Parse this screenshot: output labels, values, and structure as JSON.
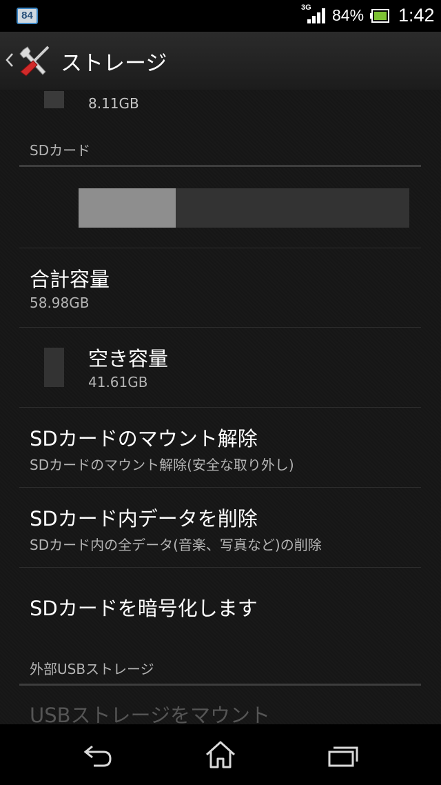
{
  "status_bar": {
    "notification_badge": "84",
    "network_type": "3G",
    "battery_percent": "84%",
    "time": "1:42",
    "icons": [
      "notification-badge-icon",
      "signal-icon",
      "battery-icon"
    ]
  },
  "action_bar": {
    "title": "ストレージ",
    "icons": [
      "back-caret-icon",
      "settings-tools-icon"
    ]
  },
  "internal": {
    "partial_size": "8.11GB"
  },
  "sd_section": {
    "header": "SDカード",
    "usage_used_fraction": 0.2945,
    "total": {
      "title": "合計容量",
      "value": "58.98GB"
    },
    "free": {
      "title": "空き容量",
      "value": "41.61GB"
    },
    "unmount": {
      "title": "SDカードのマウント解除",
      "subtitle": "SDカードのマウント解除(安全な取り外し)"
    },
    "erase": {
      "title": "SDカード内データを削除",
      "subtitle": "SDカード内の全データ(音楽、写真など)の削除"
    },
    "encrypt": {
      "title": "SDカードを暗号化します"
    }
  },
  "usb_section": {
    "header": "外部USBストレージ",
    "mount": {
      "title": "USBストレージをマウント"
    }
  },
  "nav_bar": {
    "icons": [
      "back-icon",
      "home-icon",
      "recent-apps-icon"
    ]
  },
  "colors": {
    "background": "#161616",
    "used_bar": "#8e8e8e",
    "free_bar": "#333333",
    "badge_border": "#3c86c4",
    "battery_green": "#7ec234"
  }
}
